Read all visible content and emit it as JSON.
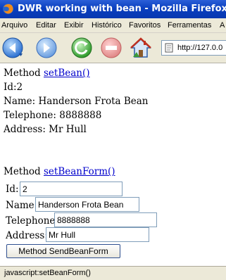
{
  "window": {
    "title": "DWR working with bean - Mozilla Firefox"
  },
  "menu": [
    "Arquivo",
    "Editar",
    "Exibir",
    "Histórico",
    "Favoritos",
    "Ferramentas",
    "A"
  ],
  "toolbar": {
    "back_icon": "back-arrow-icon",
    "forward_icon": "forward-arrow-icon",
    "reload_icon": "reload-icon",
    "stop_icon": "stop-icon",
    "home_icon": "home-icon",
    "url": "http://127.0.0"
  },
  "section1": {
    "method_prefix": "Method",
    "method_link": "setBean()",
    "id_line": "Id:2",
    "name_line": "Name: Handerson Frota Bean",
    "telephone_line": "Telephone: 8888888",
    "address_line": "Address: Mr Hull"
  },
  "section2": {
    "method_prefix": "Method",
    "method_link": "setBeanForm()",
    "id_label": "Id:",
    "id_value": "2",
    "name_label": "Name:",
    "name_value": "Handerson Frota Bean",
    "telephone_label": "Telephone:",
    "telephone_value": "8888888",
    "address_label": "Address:",
    "address_value": "Mr Hull",
    "submit_label": "Method SendBeanForm"
  },
  "status": {
    "text": "javascript:setBeanForm()"
  },
  "colors": {
    "titlebar": "#0a3fbf",
    "link": "#0000cc",
    "chrome": "#ece9d8"
  }
}
